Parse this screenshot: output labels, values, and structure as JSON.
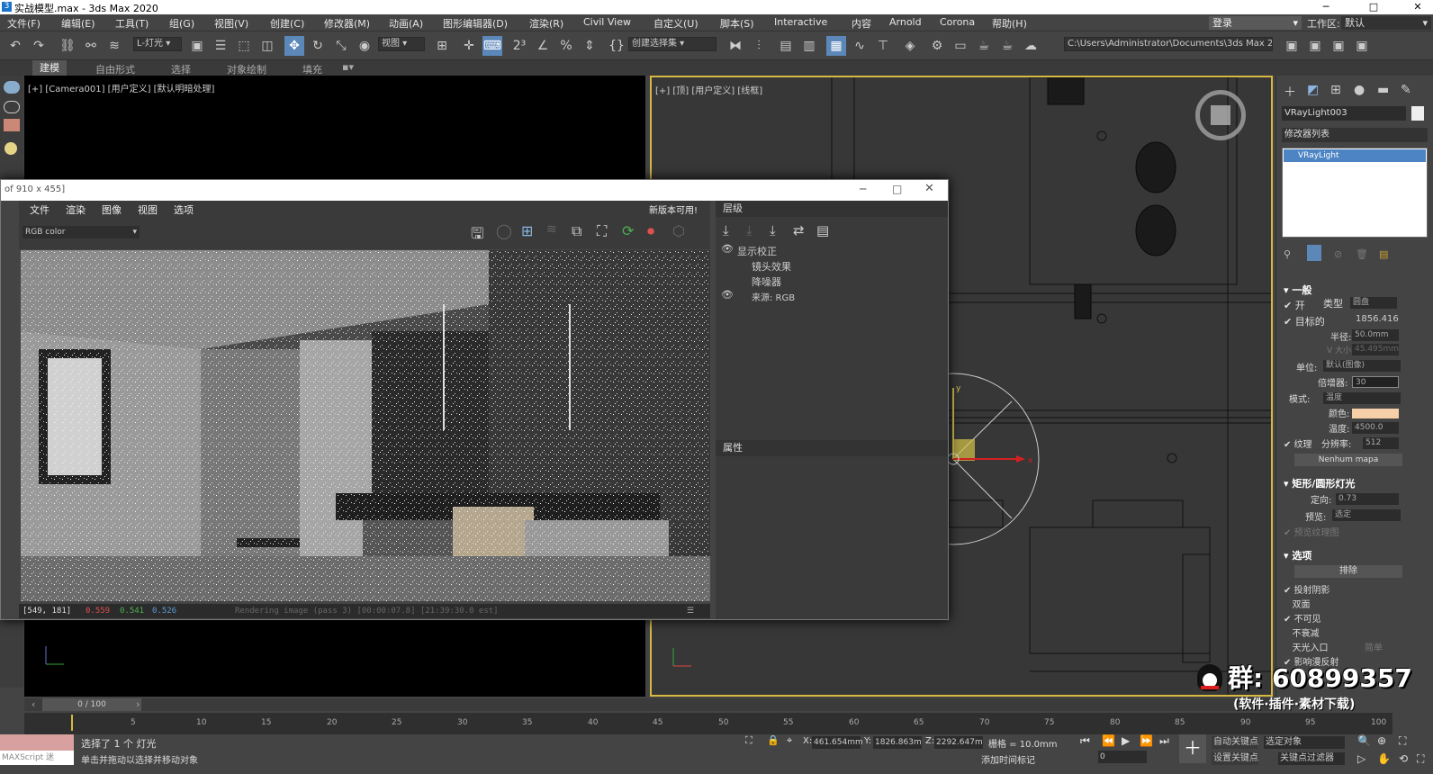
{
  "window": {
    "title": "实战模型.max - 3ds Max 2020",
    "minimize": "─",
    "maximize": "□",
    "close": "✕"
  },
  "menu": [
    "文件(F)",
    "编辑(E)",
    "工具(T)",
    "组(G)",
    "视图(V)",
    "创建(C)",
    "修改器(M)",
    "动画(A)",
    "图形编辑器(D)",
    "渲染(R)",
    "Civil View",
    "自定义(U)",
    "脚本(S)",
    "Interactive",
    "内容",
    "Arnold",
    "Corona",
    "帮助(H)"
  ],
  "account": {
    "login": "登录",
    "workspace_label": "工作区:",
    "workspace_value": "默认"
  },
  "toolbar": {
    "filter_dropdown": "L-灯光",
    "view_dropdown": "视图",
    "selection_set": "创建选择集",
    "path": "C:\\Users\\Administrator\\Documents\\3ds Max 2020"
  },
  "ribbon": {
    "tabs": [
      "建模",
      "自由形式",
      "选择",
      "对象绘制",
      "填充"
    ],
    "active": "建模"
  },
  "viewports": {
    "left_label": "[+] [Camera001] [用户定义] [默认明暗处理]",
    "right_label": "[+] [顶] [用户定义] [线框]"
  },
  "frame_buffer": {
    "title": "of 910 x 455]",
    "menu": [
      "文件",
      "渲染",
      "图像",
      "视图",
      "选项"
    ],
    "new_version": "新版本可用!",
    "channel": "RGB color",
    "status": {
      "coords": "[549, 181]",
      "r": "0.559",
      "g": "0.541",
      "b": "0.526",
      "msg": "Rendering image (pass 3) [00:00:07.8] [21:39:30.0 est]"
    },
    "layers_title": "层级",
    "layers": [
      "显示校正",
      "镜头效果",
      "降噪器",
      "来源: RGB"
    ],
    "properties_title": "属性"
  },
  "command_panel": {
    "object_name": "VRayLight003",
    "modifier_list": "修改器列表",
    "stack_item": "VRayLight",
    "general": "一般",
    "on": "开",
    "type_label": "类型",
    "type_value": "圆盘",
    "targeted": "目标的",
    "targeted_value": "1856.416",
    "radius_label": "半径:",
    "radius_value": "50.0mm",
    "vsize_label": "V 大小:",
    "vsize_value": "45.495mm",
    "units_label": "单位:",
    "units_value": "默认(图像)",
    "multiplier_label": "倍增器:",
    "multiplier_value": "30",
    "mode_label": "模式:",
    "mode_value": "温度",
    "color_label": "颜色:",
    "color_value": "#f6cfa9",
    "temp_label": "温度:",
    "temp_value": "4500.0",
    "texture_label": "纹理",
    "resolution_label": "分辨率:",
    "resolution_value": "512",
    "none_maps": "Nenhum mapa",
    "rect_section": "矩形/圆形灯光",
    "directional_label": "定向:",
    "directional_value": "0.73",
    "preview_label": "预览:",
    "preview_value": "选定",
    "preview_tex": "预览纹理图",
    "options": "选项",
    "exclude": "排除",
    "cast_shadows": "投射阴影",
    "double_sided": "双面",
    "invisible": "不可见",
    "no_decay": "不衰减",
    "skylight_portal": "天光入口",
    "simple": "简单",
    "store_irr": "影响漫反射"
  },
  "timeline": {
    "frame": "0 / 100",
    "ticks": [
      "5",
      "10",
      "15",
      "20",
      "25",
      "30",
      "35",
      "40",
      "45",
      "50",
      "55",
      "60",
      "65",
      "70",
      "75",
      "80",
      "85",
      "90",
      "95",
      "100"
    ]
  },
  "status": {
    "maxscript": "MAXScript 迷",
    "selected": "选择了 1 个 灯光",
    "hint": "单击并拖动以选择并移动对象",
    "x_label": "X:",
    "x": "461.654mm",
    "y_label": "Y:",
    "y": "1826.863m",
    "z_label": "Z:",
    "z": "2292.647m",
    "grid": "栅格 = 10.0mm",
    "add_tag": "添加时间标记",
    "auto_key": "自动关键点",
    "selected_obj": "选定对象",
    "set_key": "设置关键点",
    "key_filter": "关键点过滤器",
    "frame_field": "0"
  },
  "watermark": {
    "group": "群: 60899357",
    "tagline": "(软件·插件·素材下载)"
  }
}
